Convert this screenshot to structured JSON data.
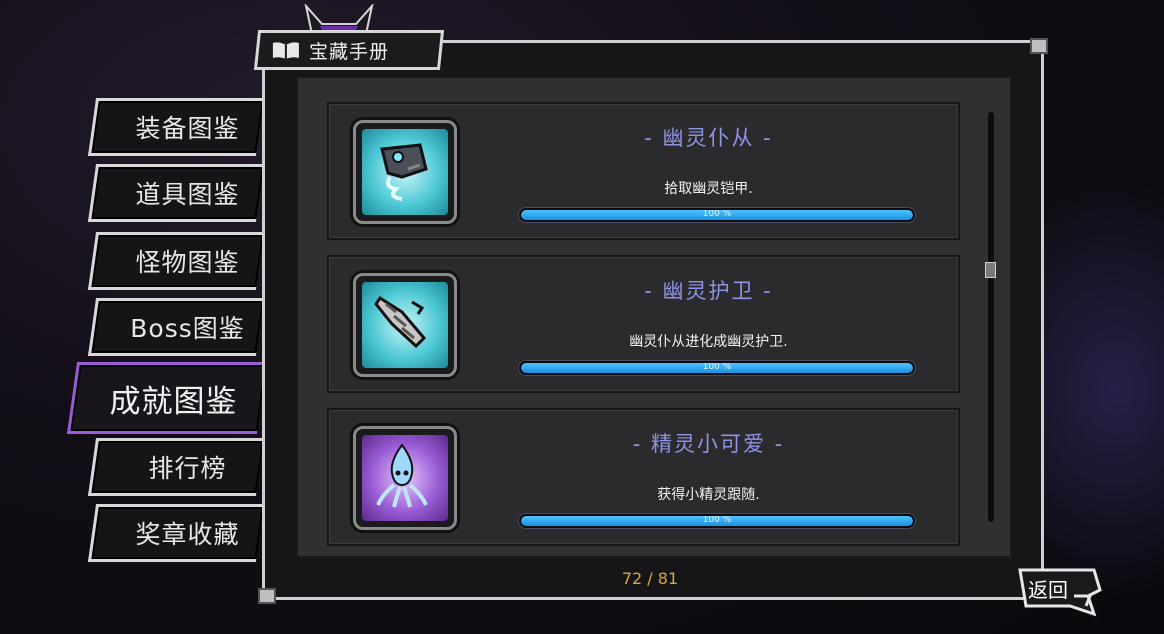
{
  "header": {
    "title": "宝藏手册"
  },
  "sidebar": {
    "items": [
      {
        "label": "装备图鉴"
      },
      {
        "label": "道具图鉴"
      },
      {
        "label": "怪物图鉴"
      },
      {
        "label": "Boss图鉴"
      },
      {
        "label": "成就图鉴",
        "active": true
      },
      {
        "label": "排行榜"
      },
      {
        "label": "奖章收藏"
      }
    ]
  },
  "achievements": [
    {
      "title": "- 幽灵仆从 -",
      "description": "拾取幽灵铠甲.",
      "progress_text": "100 %",
      "progress": 1.0,
      "icon": "ghost-armor-icon"
    },
    {
      "title": "- 幽灵护卫 -",
      "description": "幽灵仆从进化成幽灵护卫.",
      "progress_text": "100 %",
      "progress": 1.0,
      "icon": "ghost-guard-icon"
    },
    {
      "title": "- 精灵小可爱 -",
      "description": "获得小精灵跟随.",
      "progress_text": "100 %",
      "progress": 1.0,
      "icon": "spirit-pet-icon"
    }
  ],
  "footer": {
    "page_count": "72 / 81",
    "back_label": "返回"
  },
  "colors": {
    "active_tab": "#9b5cd6",
    "title_text": "#8f93e6",
    "progress": "#1a8fe0",
    "page_count": "#d9a640"
  }
}
